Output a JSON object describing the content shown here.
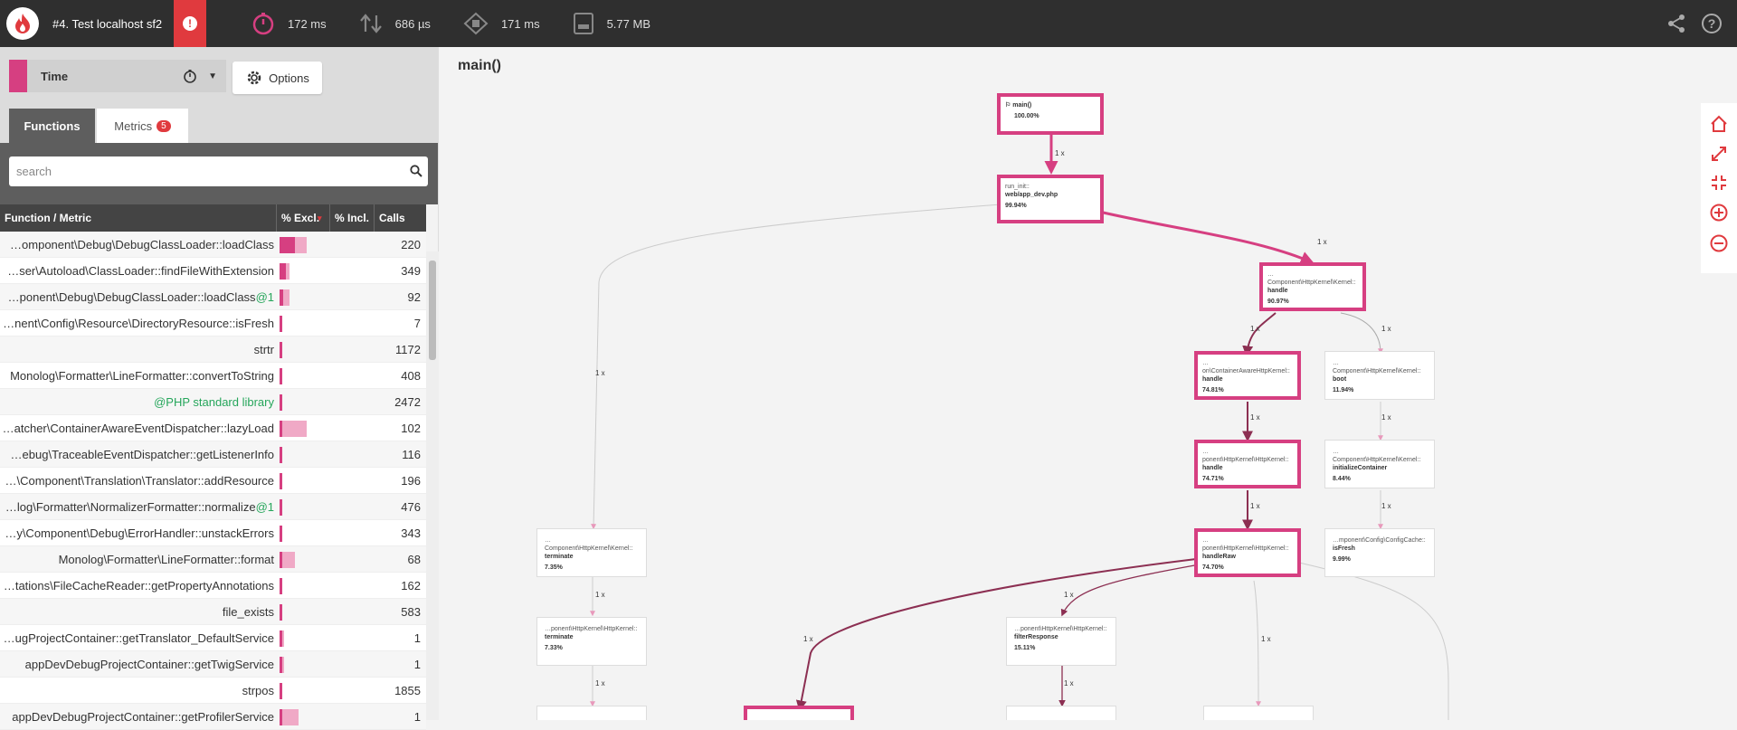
{
  "topbar": {
    "title": "#4. Test localhost sf2",
    "wall_time": "172 ms",
    "io_time": "686 µs",
    "cpu_time": "171 ms",
    "memory": "5.77 MB"
  },
  "dimension": {
    "label": "Time",
    "color": "#d63f81"
  },
  "options_label": "Options",
  "tabs": {
    "functions": "Functions",
    "metrics": "Metrics",
    "metrics_badge": "5"
  },
  "search": {
    "placeholder": "search"
  },
  "table": {
    "headers": {
      "name": "Function / Metric",
      "excl": "% Excl.",
      "incl": "% Incl.",
      "calls": "Calls"
    },
    "rows": [
      {
        "name": "…omponent\\Debug\\DebugClassLoader::loadClass",
        "suffix": "",
        "excl": 0.55,
        "incl": 1.0,
        "calls": "220"
      },
      {
        "name": "…ser\\Autoload\\ClassLoader::findFileWithExtension",
        "suffix": "",
        "excl": 0.22,
        "incl": 0.35,
        "calls": "349"
      },
      {
        "name": "…ponent\\Debug\\DebugClassLoader::loadClass",
        "suffix": "@1",
        "excl": 0.12,
        "incl": 0.35,
        "calls": "92"
      },
      {
        "name": "…nent\\Config\\Resource\\DirectoryResource::isFresh",
        "suffix": "",
        "excl": 0.1,
        "incl": 0.1,
        "calls": "7"
      },
      {
        "name": "strtr",
        "suffix": "",
        "excl": 0.1,
        "incl": 0.1,
        "calls": "1172"
      },
      {
        "name": "Monolog\\Formatter\\LineFormatter::convertToString",
        "suffix": "",
        "excl": 0.08,
        "incl": 0.1,
        "calls": "408"
      },
      {
        "name": "@PHP standard library",
        "suffix": "",
        "excl": 0.08,
        "incl": 0.08,
        "calls": "2472",
        "lib": true
      },
      {
        "name": "…atcher\\ContainerAwareEventDispatcher::lazyLoad",
        "suffix": "",
        "excl": 0.08,
        "incl": 1.0,
        "calls": "102"
      },
      {
        "name": "…ebug\\TraceableEventDispatcher::getListenerInfo",
        "suffix": "",
        "excl": 0.07,
        "incl": 0.07,
        "calls": "116"
      },
      {
        "name": "…\\Component\\Translation\\Translator::addResource",
        "suffix": "",
        "excl": 0.07,
        "incl": 0.07,
        "calls": "196"
      },
      {
        "name": "…log\\Formatter\\NormalizerFormatter::normalize",
        "suffix": "@1",
        "excl": 0.07,
        "incl": 0.09,
        "calls": "476"
      },
      {
        "name": "…y\\Component\\Debug\\ErrorHandler::unstackErrors",
        "suffix": "",
        "excl": 0.06,
        "incl": 0.06,
        "calls": "343"
      },
      {
        "name": "Monolog\\Formatter\\LineFormatter::format",
        "suffix": "",
        "excl": 0.06,
        "incl": 0.58,
        "calls": "68"
      },
      {
        "name": "…tations\\FileCacheReader::getPropertyAnnotations",
        "suffix": "",
        "excl": 0.06,
        "incl": 0.06,
        "calls": "162"
      },
      {
        "name": "file_exists",
        "suffix": "",
        "excl": 0.06,
        "incl": 0.06,
        "calls": "583"
      },
      {
        "name": "…ugProjectContainer::getTranslator_DefaultService",
        "suffix": "",
        "excl": 0.06,
        "incl": 0.15,
        "calls": "1"
      },
      {
        "name": "appDevDebugProjectContainer::getTwigService",
        "suffix": "",
        "excl": 0.06,
        "incl": 0.15,
        "calls": "1"
      },
      {
        "name": "strpos",
        "suffix": "",
        "excl": 0.06,
        "incl": 0.06,
        "calls": "1855"
      },
      {
        "name": "appDevDebugProjectContainer::getProfilerService",
        "suffix": "",
        "excl": 0.06,
        "incl": 0.7,
        "calls": "1"
      }
    ]
  },
  "graph": {
    "title": "main()",
    "nodes": [
      {
        "id": "n-main",
        "ns": "",
        "fn": "main()",
        "pct": "100.00%",
        "flag": true,
        "hot": true
      },
      {
        "id": "n-runinit",
        "ns": "run_init::",
        "fn": "web/app_dev.php",
        "pct": "99.94%",
        "hot": true
      },
      {
        "id": "n-kernel-handle",
        "ns": "…Component\\HttpKernel\\Kernel::",
        "fn": "handle",
        "pct": "90.97%",
        "hot": true
      },
      {
        "id": "n-container-handle",
        "ns": "…on\\ContainerAwareHttpKernel::",
        "fn": "handle",
        "pct": "74.81%",
        "hot": true
      },
      {
        "id": "n-boot",
        "ns": "…Component\\HttpKernel\\Kernel::",
        "fn": "boot",
        "pct": "11.94%",
        "hot": false
      },
      {
        "id": "n-httpkernel-handle",
        "ns": "…ponent\\HttpKernel\\HttpKernel::",
        "fn": "handle",
        "pct": "74.71%",
        "hot": true
      },
      {
        "id": "n-init-container",
        "ns": "…Component\\HttpKernel\\Kernel::",
        "fn": "initializeContainer",
        "pct": "8.44%",
        "hot": false
      },
      {
        "id": "n-handleraw",
        "ns": "…ponent\\HttpKernel\\HttpKernel::",
        "fn": "handleRaw",
        "pct": "74.70%",
        "hot": true
      },
      {
        "id": "n-isfresh",
        "ns": "…mponent\\Config\\ConfigCache::",
        "fn": "isFresh",
        "pct": "9.99%",
        "hot": false
      },
      {
        "id": "n-kernel-terminate",
        "ns": "…Component\\HttpKernel\\Kernel::",
        "fn": "terminate",
        "pct": "7.35%",
        "hot": false
      },
      {
        "id": "n-httpkernel-terminate",
        "ns": "…ponent\\HttpKernel\\HttpKernel::",
        "fn": "terminate",
        "pct": "7.33%",
        "hot": false
      },
      {
        "id": "n-filterresponse",
        "ns": "…ponent\\HttpKernel\\HttpKernel::",
        "fn": "filterResponse",
        "pct": "15.11%",
        "hot": false
      }
    ],
    "edge_label": "1 x"
  }
}
